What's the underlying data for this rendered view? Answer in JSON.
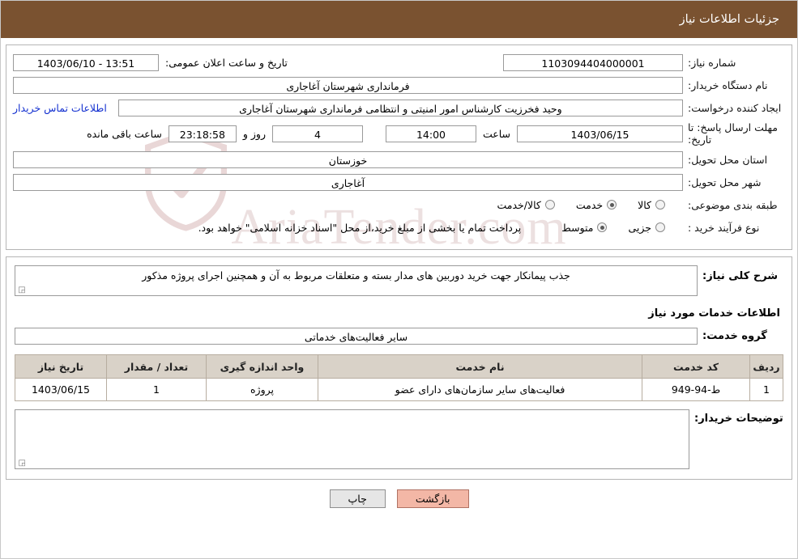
{
  "header": {
    "title": "جزئیات اطلاعات نیاز"
  },
  "watermark": {
    "text": "AriaTender.com",
    "shield": "shield-icon"
  },
  "form": {
    "need_number_label": "شماره نیاز:",
    "need_number_value": "1103094404000001",
    "announce_datetime_label": "تاریخ و ساعت اعلان عمومی:",
    "announce_datetime_value": "13:51 - 1403/06/10",
    "buyer_org_label": "نام دستگاه خریدار:",
    "buyer_org_value": "فرمانداری شهرستان آغاجاری",
    "requester_label": "ایجاد کننده درخواست:",
    "requester_value": "وحید فخرزیت کارشناس امور امنیتی و انتظامی فرمانداری شهرستان آغاجاری",
    "contact_link": "اطلاعات تماس خریدار",
    "deadline_label": "مهلت ارسال پاسخ: تا تاریخ:",
    "deadline_date": "1403/06/15",
    "hour_label": "ساعت",
    "deadline_time": "14:00",
    "days_value": "4",
    "days_label": "روز و",
    "countdown_value": "23:18:58",
    "remaining_label": "ساعت باقی مانده",
    "province_label": "استان محل تحویل:",
    "province_value": "خوزستان",
    "city_label": "شهر محل تحویل:",
    "city_value": "آغاجاری",
    "category_label": "طبقه بندی موضوعی:",
    "category_options": [
      {
        "label": "کالا",
        "selected": false
      },
      {
        "label": "خدمت",
        "selected": true
      },
      {
        "label": "کالا/خدمت",
        "selected": false
      }
    ],
    "process_label": "نوع فرآیند خرید :",
    "process_options": [
      {
        "label": "جزیی",
        "selected": false
      },
      {
        "label": "متوسط",
        "selected": true
      }
    ],
    "process_note": "پرداخت تمام یا بخشی از مبلغ خرید،از محل \"اسناد خزانه اسلامی\" خواهد بود."
  },
  "details": {
    "summary_label": "شرح کلی نیاز:",
    "summary_value": "جذب پیمانکار جهت خرید دوربین های مدار بسته و متعلقات مربوط به آن و همچنین اجرای پروژه مذکور",
    "services_title": "اطلاعات خدمات مورد نیاز",
    "service_group_label": "گروه خدمت:",
    "service_group_value": "سایر فعالیت‌های خدماتی",
    "table": {
      "columns": [
        "ردیف",
        "کد خدمت",
        "نام خدمت",
        "واحد اندازه گیری",
        "تعداد / مقدار",
        "تاریخ نیاز"
      ],
      "rows": [
        [
          "1",
          "ط-94-949",
          "فعالیت‌های سایر سازمان‌های دارای عضو",
          "پروژه",
          "1",
          "1403/06/15"
        ]
      ]
    },
    "buyer_notes_label": "توضیحات خریدار:",
    "buyer_notes_value": ""
  },
  "footer": {
    "print_label": "چاپ",
    "back_label": "بازگشت"
  }
}
